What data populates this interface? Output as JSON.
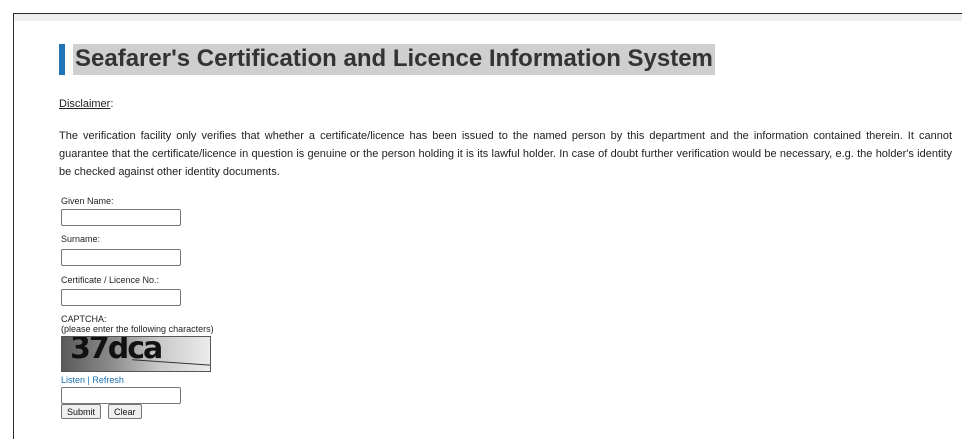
{
  "page": {
    "title": "Seafarer's Certification and Licence Information System",
    "disclaimer_label": "Disclaimer",
    "disclaimer_text": "The verification facility only verifies that whether a certificate/licence has been issued to the named person by this department and the information contained therein. It cannot guarantee that the certificate/licence in question is genuine or the person holding it is its lawful holder. In case of doubt further verification would be necessary, e.g. the holder's identity be checked against other identity documents."
  },
  "form": {
    "given_name_label": "Given Name:",
    "given_name_value": "",
    "surname_label": "Surname:",
    "surname_value": "",
    "certificate_label": "Certificate / Licence No.:",
    "certificate_value": "",
    "captcha_label": "CAPTCHA:",
    "captcha_hint": "(please enter the following characters)",
    "captcha_image_text": "37dca",
    "listen_label": "Listen",
    "refresh_label": "Refresh",
    "captcha_value": "",
    "submit_label": "Submit",
    "clear_label": "Clear"
  },
  "colors": {
    "accent": "#1f73b7",
    "title_bg": "#cfcfcf",
    "link": "#1a6fb0"
  }
}
